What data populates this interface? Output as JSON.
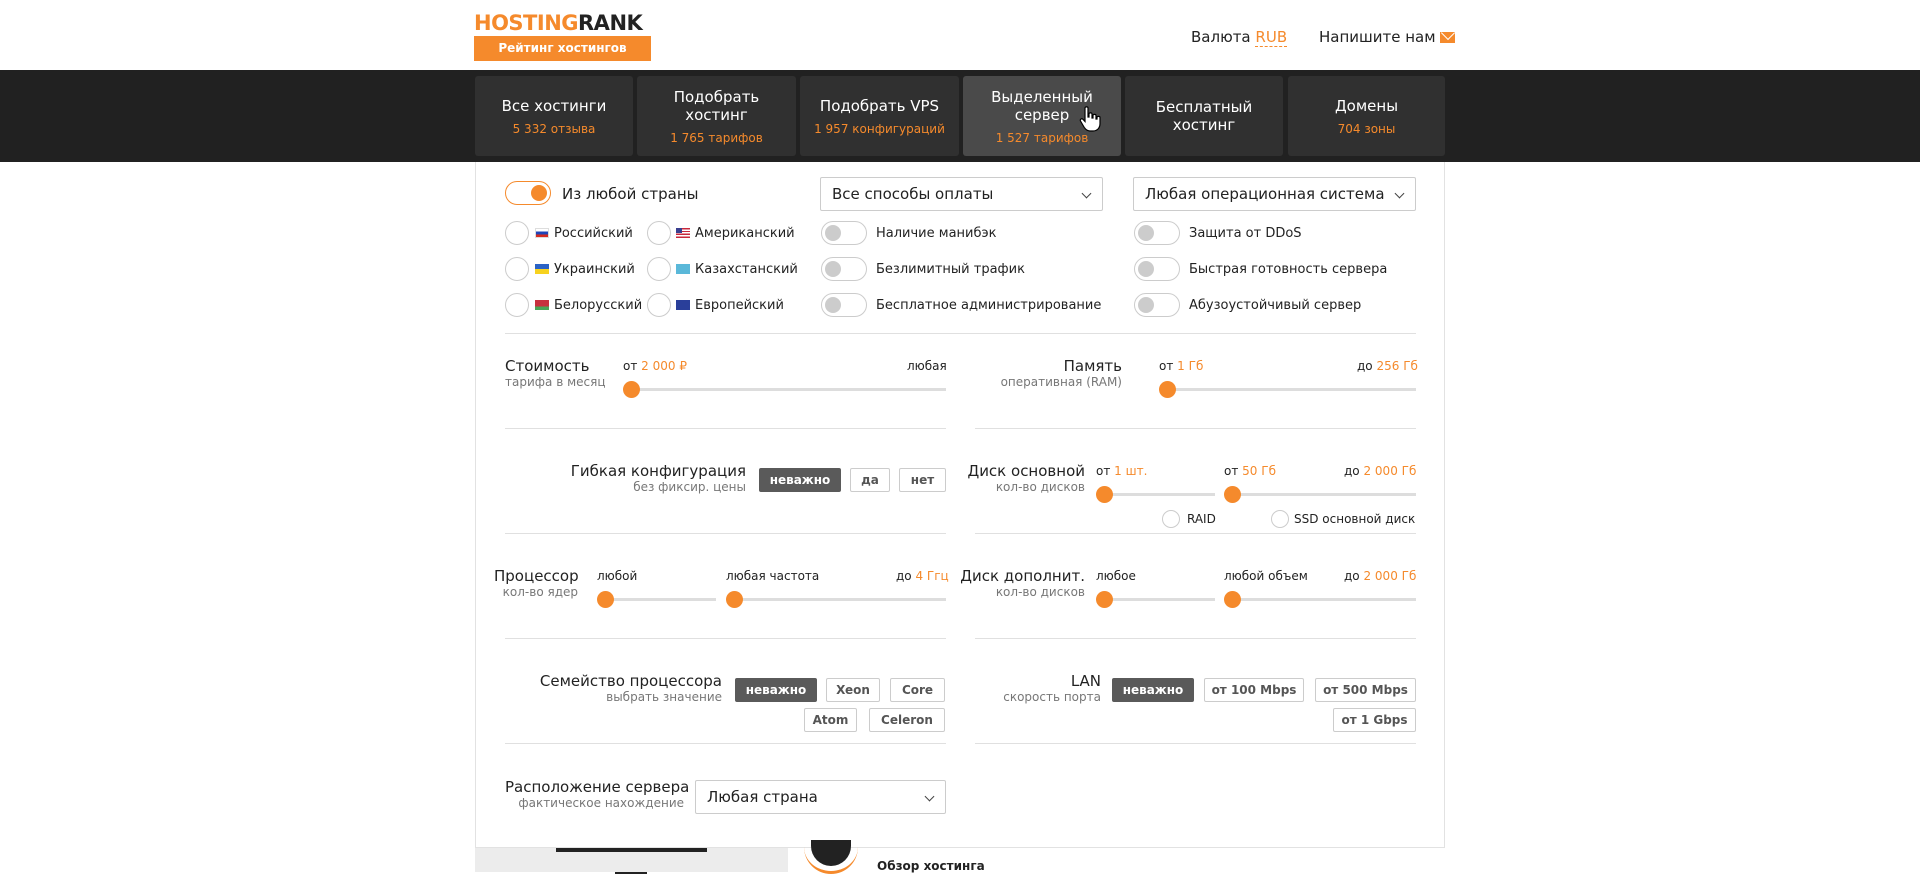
{
  "header": {
    "logo_part1": "HOSTING",
    "logo_part2": "RANK",
    "logo_tagline": "Рейтинг хостингов",
    "currency_label": "Валюта",
    "currency_value": "RUB",
    "contact_label": "Напишите нам"
  },
  "nav": [
    {
      "title": "Все хостинги",
      "sub": "5 332 отзыва"
    },
    {
      "title": "Подобрать хостинг",
      "sub": "1 765 тарифов"
    },
    {
      "title": "Подобрать VPS",
      "sub": "1 957 конфигураций"
    },
    {
      "title": "Выделенный сервер",
      "sub": "1 527 тарифов"
    },
    {
      "title": "Бесплатный хостинг",
      "sub": ""
    },
    {
      "title": "Домены",
      "sub": "704 зоны"
    }
  ],
  "filters": {
    "any_country_toggle": "Из любой страны",
    "payment_select": "Все способы оплаты",
    "os_select": "Любая операционная система",
    "countries": [
      "Российский",
      "Американский",
      "Украинский",
      "Казахстанский",
      "Белорусский",
      "Европейский"
    ],
    "features_left": [
      "Наличие манибэк",
      "Безлимитный трафик",
      "Бесплатное администрирование"
    ],
    "features_right": [
      "Защита от DDoS",
      "Быстрая готовность сервера",
      "Абузоустойчивый сервер"
    ]
  },
  "cost": {
    "title": "Стоимость",
    "sub": "тарифа в месяц",
    "from_prefix": "от",
    "from_value": "2 000 ₽",
    "to_label": "любая",
    "level": 0
  },
  "memory": {
    "title": "Память",
    "sub": "оперативная (RAM)",
    "from_prefix": "от",
    "from_value": "1 Гб",
    "to_prefix": "до",
    "to_value": "256 Гб",
    "level": 0
  },
  "flex": {
    "title": "Гибкая конфигурация",
    "sub": "без фиксир. цены",
    "options": [
      "неважно",
      "да",
      "нет"
    ],
    "selected": "неважно"
  },
  "disk_main": {
    "title": "Диск основной",
    "sub": "кол-во дисков",
    "count_prefix": "от",
    "count_value": "1 шт.",
    "size_prefix": "от",
    "size_value": "50 Гб",
    "to_prefix": "до",
    "to_value": "2 000 Гб",
    "raid": "RAID",
    "ssd": "SSD основной диск"
  },
  "cpu": {
    "title": "Процессор",
    "sub": "кол-во ядер",
    "cores_label": "любой",
    "freq_label": "любая частота",
    "to_prefix": "до",
    "to_value": "4 Ггц"
  },
  "disk_extra": {
    "title": "Диск дополнит.",
    "sub": "кол-во дисков",
    "count_label": "любое",
    "size_label": "любой объем",
    "to_prefix": "до",
    "to_value": "2 000 Гб"
  },
  "cpu_family": {
    "title": "Семейство процессора",
    "sub": "выбрать значение",
    "options": [
      "неважно",
      "Xeon",
      "Core",
      "Atom",
      "Celeron"
    ],
    "selected": "неважно"
  },
  "lan": {
    "title": "LAN",
    "sub": "скорость порта",
    "options": [
      "неважно",
      "от 100 Mbps",
      "от 500 Mbps",
      "от 1 Gbps"
    ],
    "selected": "неважно"
  },
  "location": {
    "title": "Расположение сервера",
    "sub": "фактическое нахождение",
    "select": "Любая страна"
  },
  "peek": {
    "review_label": "Обзор хостинга"
  },
  "colors": {
    "accent": "#f58a2c",
    "nav_bg": "#212121",
    "selected_btn": "#5a5a5a"
  }
}
